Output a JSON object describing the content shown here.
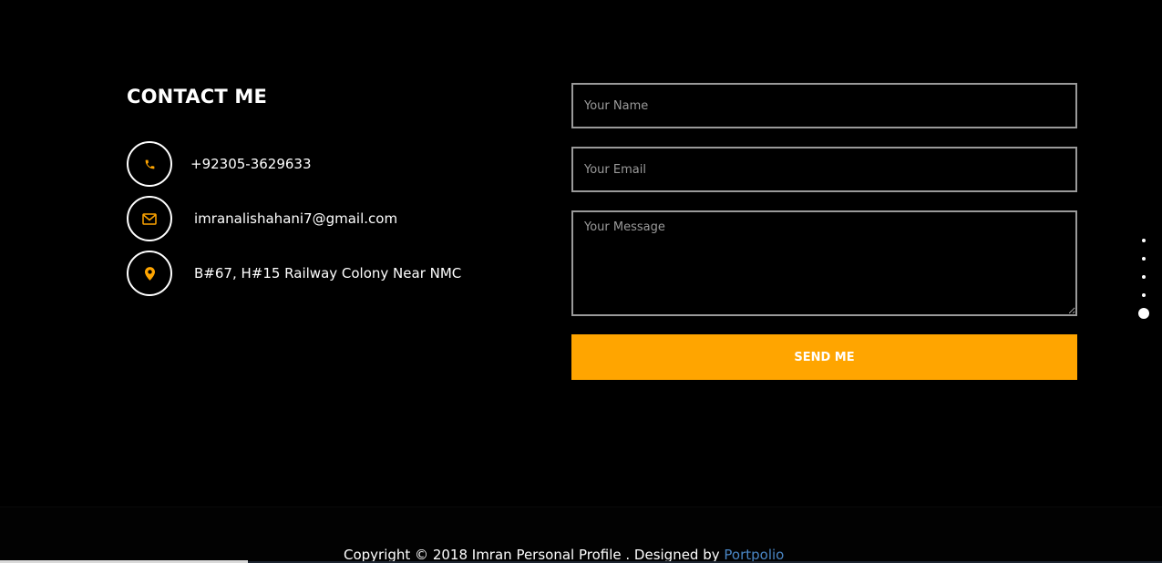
{
  "contact": {
    "title": "CONTACT ME",
    "phone": "+92305-3629633",
    "email": "imranalishahani7@gmail.com",
    "address": "B#67, H#15 Railway Colony Near NMC",
    "icon_color": "#ffa500"
  },
  "form": {
    "name_placeholder": "Your Name",
    "email_placeholder": "Your Email",
    "message_placeholder": "Your Message",
    "send_label": "SEND ME",
    "button_color": "#ffa500"
  },
  "dot_nav": {
    "count": 5,
    "active_index": 5
  },
  "footer": {
    "copyright_text": "Copyright © 2018 Imran Personal Profile . Designed by ",
    "designer_link": "Portpolio",
    "link_color": "#4a86c5"
  },
  "icons": [
    "phone-icon",
    "envelope-icon",
    "map-marker-icon"
  ]
}
